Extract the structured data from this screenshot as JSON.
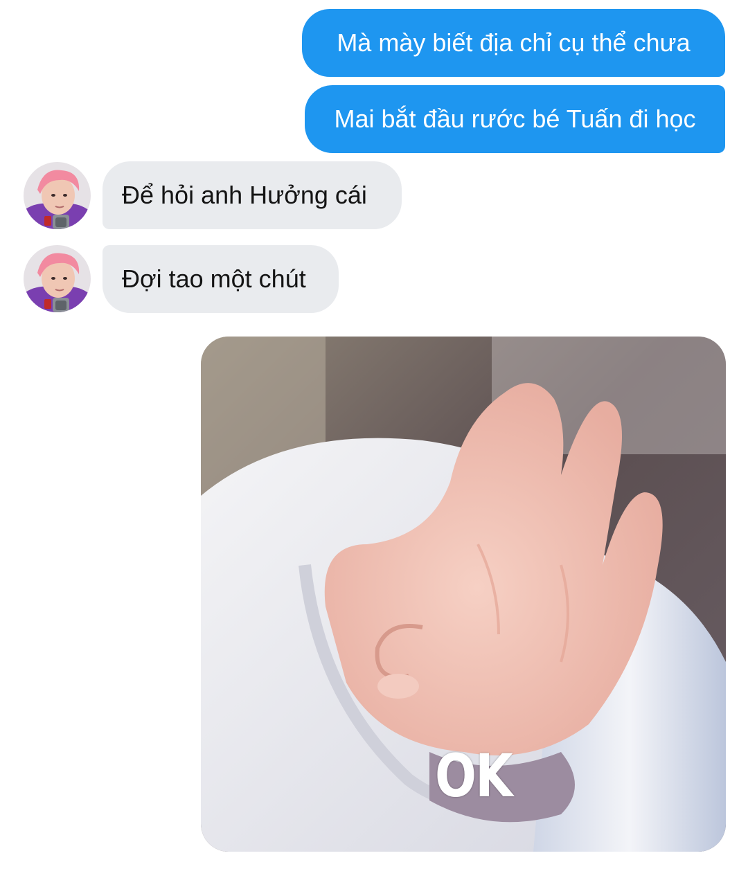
{
  "conversation": {
    "messages": [
      {
        "direction": "outgoing",
        "text": "Mà mày biết địa chỉ cụ thể chưa"
      },
      {
        "direction": "outgoing",
        "text": "Mai bắt đầu rước bé Tuấn đi học"
      },
      {
        "direction": "incoming",
        "text": "Để hỏi anh Hưởng cái"
      },
      {
        "direction": "incoming",
        "text": "Đợi tao một chút"
      }
    ],
    "sticker": {
      "caption": "OK"
    }
  },
  "colors": {
    "outgoing_bubble": "#1e96f0",
    "incoming_bubble": "#e9ebee",
    "background": "#ffffff"
  },
  "icons": {
    "avatar": "contact-avatar"
  }
}
